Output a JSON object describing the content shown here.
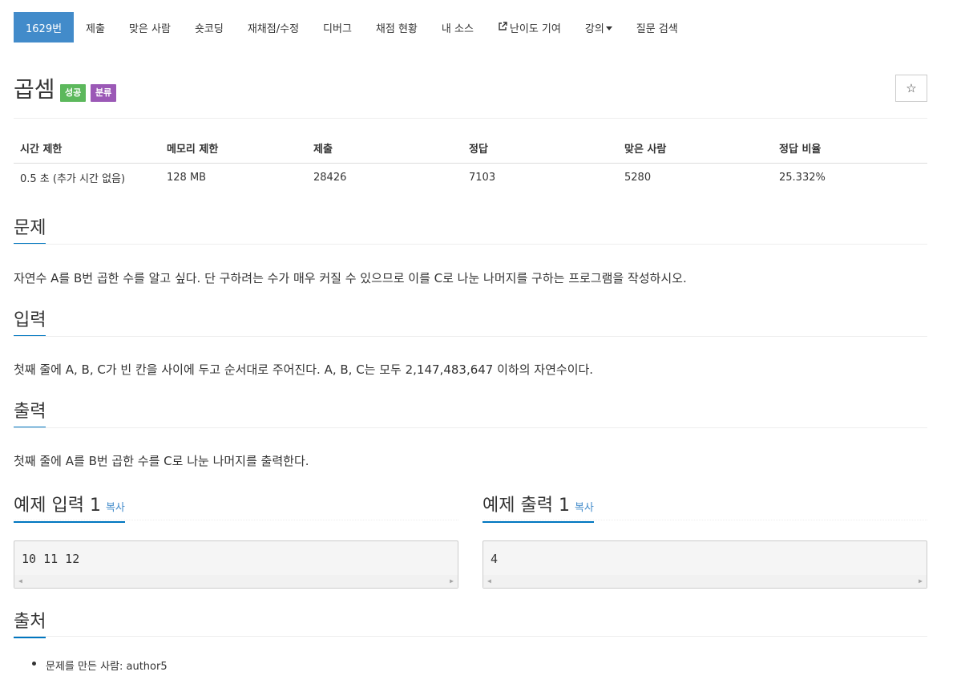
{
  "nav": {
    "items": [
      "1629번",
      "제출",
      "맞은 사람",
      "숏코딩",
      "재채점/수정",
      "디버그",
      "채점 현황",
      "내 소스",
      "난이도 기여",
      "강의",
      "질문 검색"
    ]
  },
  "problem": {
    "title": "곱셈",
    "badge_success": "성공",
    "badge_category": "분류",
    "star": "☆"
  },
  "info": {
    "headers": [
      "시간 제한",
      "메모리 제한",
      "제출",
      "정답",
      "맞은 사람",
      "정답 비율"
    ],
    "values": [
      "0.5 초 (추가 시간 없음)",
      "128 MB",
      "28426",
      "7103",
      "5280",
      "25.332%"
    ]
  },
  "sections": {
    "problem_heading": "문제",
    "problem_text": "자연수 A를 B번 곱한 수를 알고 싶다. 단 구하려는 수가 매우 커질 수 있으므로 이를 C로 나눈 나머지를 구하는 프로그램을 작성하시오.",
    "input_heading": "입력",
    "input_text": "첫째 줄에 A, B, C가 빈 칸을 사이에 두고 순서대로 주어진다. A, B, C는 모두 2,147,483,647 이하의 자연수이다.",
    "output_heading": "출력",
    "output_text": "첫째 줄에 A를 B번 곱한 수를 C로 나눈 나머지를 출력한다.",
    "source_heading": "출처"
  },
  "samples": {
    "input_heading": "예제 입력 1",
    "output_heading": "예제 출력 1",
    "copy_label": "복사",
    "input_value": "10 11 12",
    "output_value": "4"
  },
  "source": {
    "item": "문제를 만든 사람: author5"
  }
}
